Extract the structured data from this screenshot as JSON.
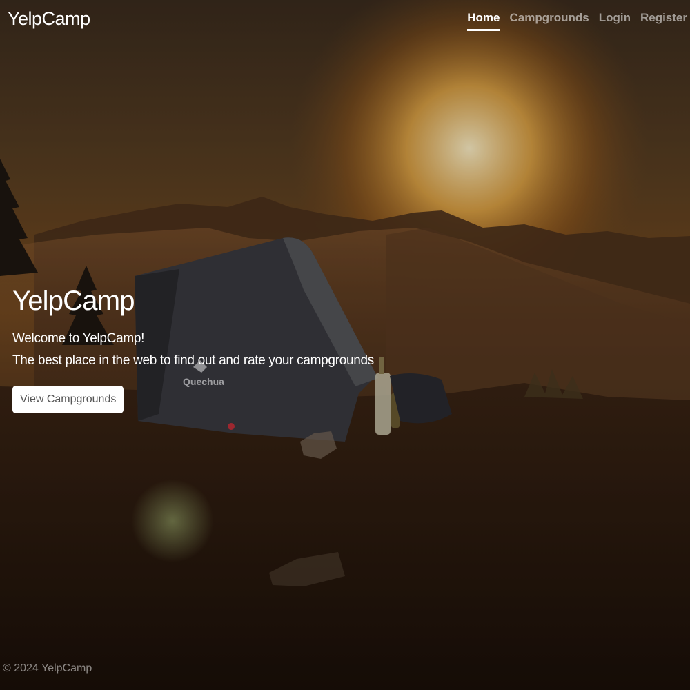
{
  "navbar": {
    "brand": "YelpCamp",
    "links": [
      {
        "label": "Home",
        "active": true
      },
      {
        "label": "Campgrounds",
        "active": false
      },
      {
        "label": "Login",
        "active": false
      },
      {
        "label": "Register",
        "active": false
      }
    ]
  },
  "hero": {
    "title": "YelpCamp",
    "lead_line1": "Welcome to YelpCamp!",
    "lead_line2": "The best place in the web to find out and rate your campgrounds",
    "button_label": "View Campgrounds",
    "tent_brand": "Quechua"
  },
  "footer": {
    "text": "© 2024 YelpCamp"
  },
  "colors": {
    "sky_top": "#3a2a1a",
    "sun": "#f5c25a",
    "button_bg": "#ffffff",
    "button_text": "#555555"
  }
}
